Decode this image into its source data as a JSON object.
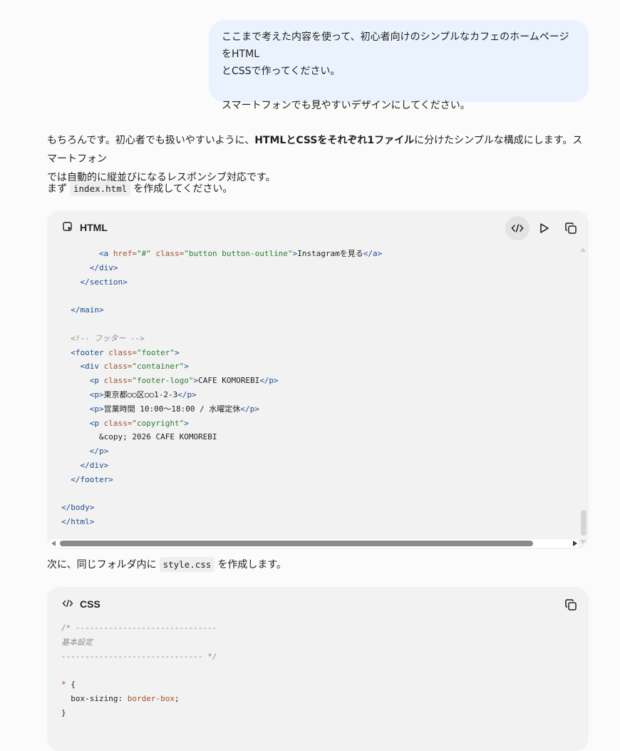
{
  "user_message": {
    "line1": "ここまで考えた内容を使って、初心者向けのシンプルなカフェのホームページをHTML",
    "line2": "とCSSで作ってください。",
    "line3": "スマートフォンでも見やすいデザインにしてください。"
  },
  "assistant": {
    "intro_a": "もちろんです。初心者でも扱いやすいように、",
    "intro_bold": "HTMLとCSSをそれぞれ1ファイル",
    "intro_b": "に分けたシンプルな構成にします。スマートフォン",
    "intro_c": "では自動的に縦並びになるレスポンシブ対応です。",
    "step1_prefix": "まず",
    "step1_file": "index.html",
    "step1_suffix": "を作成してください。",
    "step2_prefix": "次に、同じフォルダ内に",
    "step2_file": "style.css",
    "step2_suffix": "を作成します。"
  },
  "html_block": {
    "title": "HTML",
    "icons": [
      "code-view-icon",
      "play-icon",
      "copy-icon"
    ],
    "lines": {
      "l1_text": "Instagramを見る",
      "l5_comment": "<!-- フッター -->",
      "l8_text": "CAFE KOMOREBI",
      "l9_text": "東京都○○区○○1-2-3",
      "l10_text": "営業時間 10:00〜18:00 / 水曜定休",
      "l12_text": "&copy; 2026 CAFE KOMOREBI"
    }
  },
  "css_block": {
    "title": "CSS",
    "icons": [
      "code-icon",
      "copy-icon"
    ],
    "comment_line1": "/* ------------------------------",
    "comment_line2": "基本設定",
    "comment_line3": "------------------------------ */",
    "selector": "*",
    "property": "box-sizing",
    "value": "border-box"
  }
}
